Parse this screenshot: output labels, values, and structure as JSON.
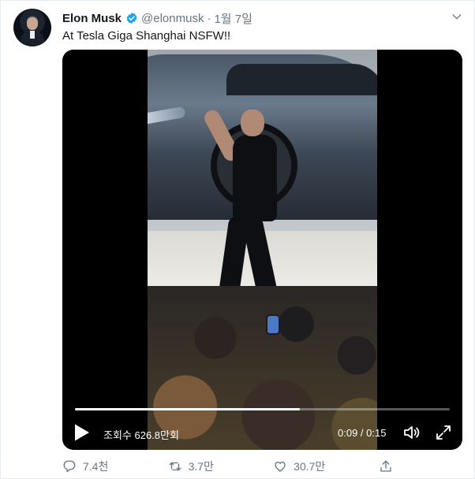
{
  "tweet": {
    "author_name": "Elon Musk",
    "author_handle": "@elonmusk",
    "separator": "·",
    "date": "1월 7일",
    "text": "At Tesla Giga Shanghai NSFW!!"
  },
  "video": {
    "views": "조회수 626.8만회",
    "time": "0:09 / 0:15",
    "progress_fraction": 0.6
  },
  "actions": {
    "replies": "7.4천",
    "retweets": "3.7만",
    "likes": "30.7만"
  },
  "icons": {
    "verified": "verified-badge-icon",
    "more": "chevron-down-icon",
    "play": "play-icon",
    "volume": "volume-icon",
    "fullscreen": "fullscreen-icon",
    "reply": "reply-icon",
    "retweet": "retweet-icon",
    "like": "heart-icon",
    "share": "share-icon"
  },
  "colors": {
    "verified_blue": "#1da1f2",
    "secondary_text": "#657786",
    "video_background": "#000000"
  }
}
